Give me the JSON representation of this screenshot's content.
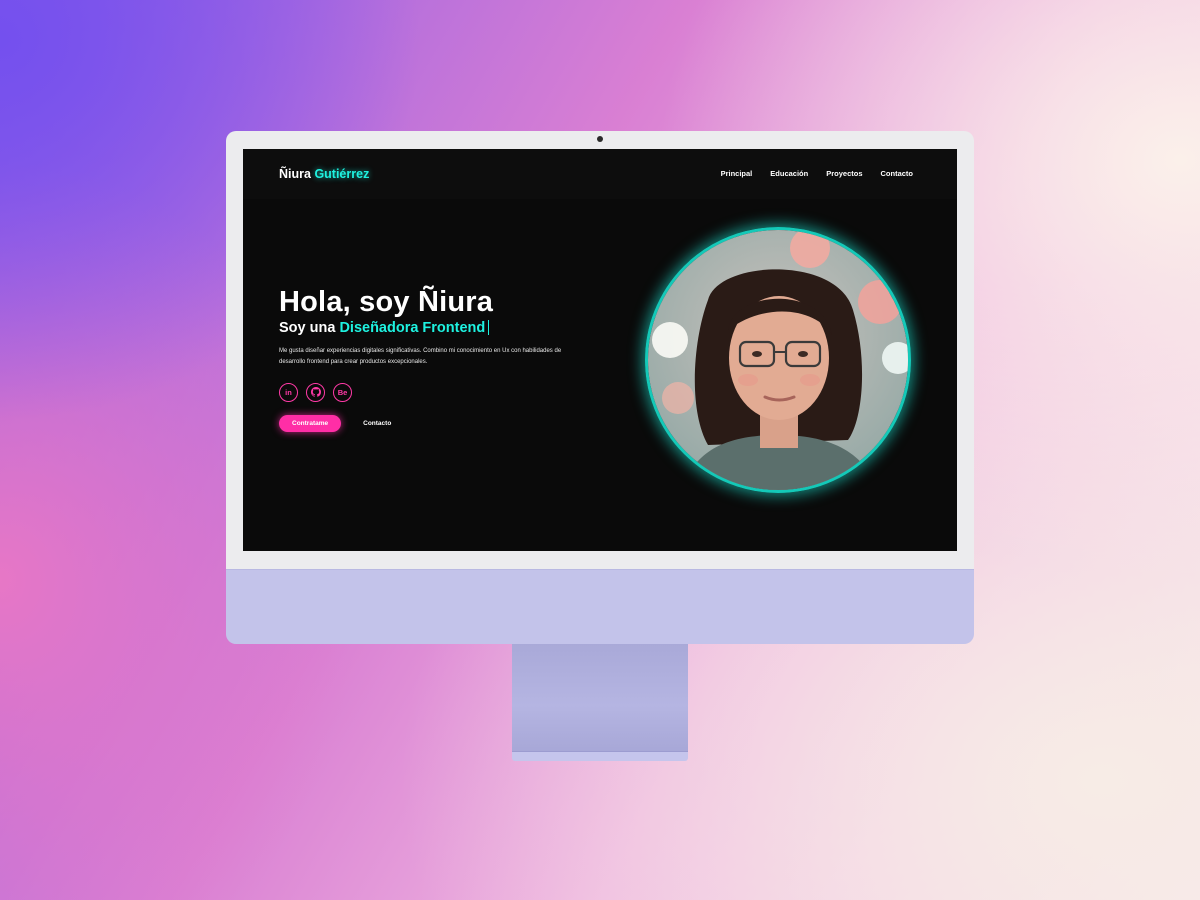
{
  "site": {
    "logo_first": "Ñiura",
    "logo_accent": "Gutiérrez",
    "nav": [
      "Principal",
      "Educación",
      "Proyectos",
      "Contacto"
    ]
  },
  "hero": {
    "greeting": "Hola, soy Ñiura",
    "role_prefix": "Soy una",
    "role_accent": "Diseñadora Frontend",
    "description": "Me gusta diseñar experiencias digitales significativas. Combino mi conocimiento en Ux con habilidades de desarrollo frontend para crear productos excepcionales.",
    "socials": [
      "in",
      "github-icon",
      "Be"
    ],
    "primary_button": "Contratame",
    "secondary_button": "Contacto"
  },
  "colors": {
    "accent_teal": "#1ef2e0",
    "accent_pink": "#ff2ea6",
    "screen_bg": "#0a0a0a"
  }
}
